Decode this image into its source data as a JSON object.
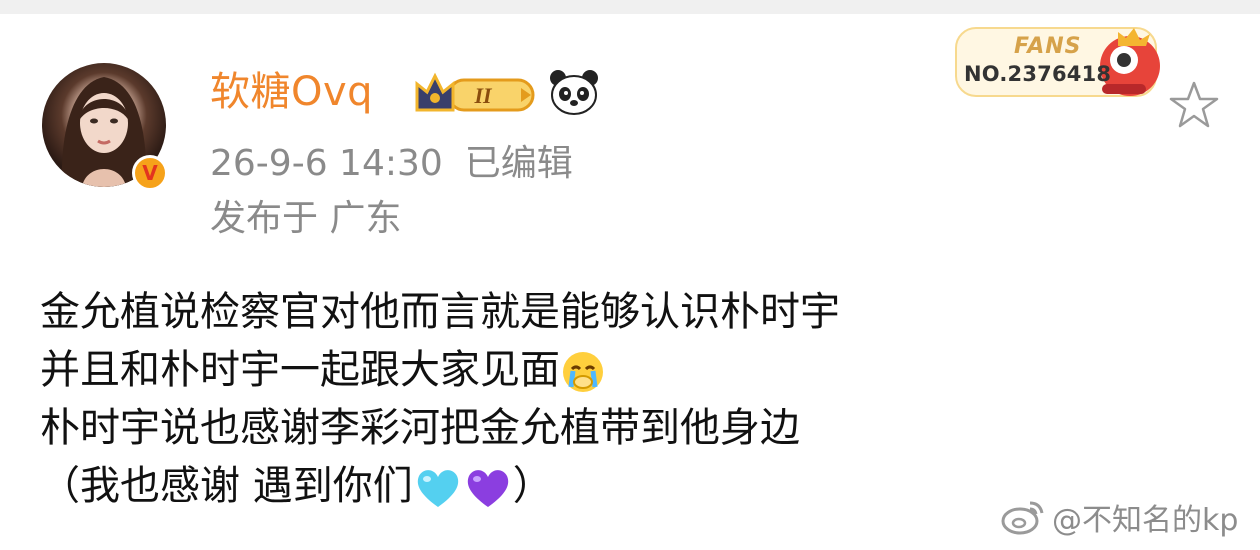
{
  "post": {
    "username": "软糖Ovq",
    "timestamp": "26-9-6 14:30",
    "edited_label": "已编辑",
    "location_label": "发布于 广东",
    "level_badge": "II",
    "fans_badge": {
      "label": "FANS",
      "number": "NO.2376418"
    },
    "lines": [
      "金允植说检察官对他而言就是能够认识朴时宇",
      "并且和朴时宇一起跟大家见面",
      "朴时宇说也感谢李彩河把金允植带到他身边",
      "（我也感谢 遇到你们",
      "）"
    ]
  },
  "watermark": {
    "text": "@不知名的kp"
  },
  "icons": {
    "verified": "verified-badge-icon",
    "crown": "crown-level-badge-icon",
    "panda": "panda-icon",
    "star": "star-favorite-icon",
    "crying": "crying-face-emoji",
    "light_blue_heart": "light-blue-heart-emoji",
    "purple_heart": "purple-heart-emoji",
    "weibo": "weibo-logo-icon"
  },
  "colors": {
    "username": "#f0862c",
    "meta": "#8a8a8a",
    "body_text": "#111111",
    "verify_badge": "#f6a21a"
  }
}
